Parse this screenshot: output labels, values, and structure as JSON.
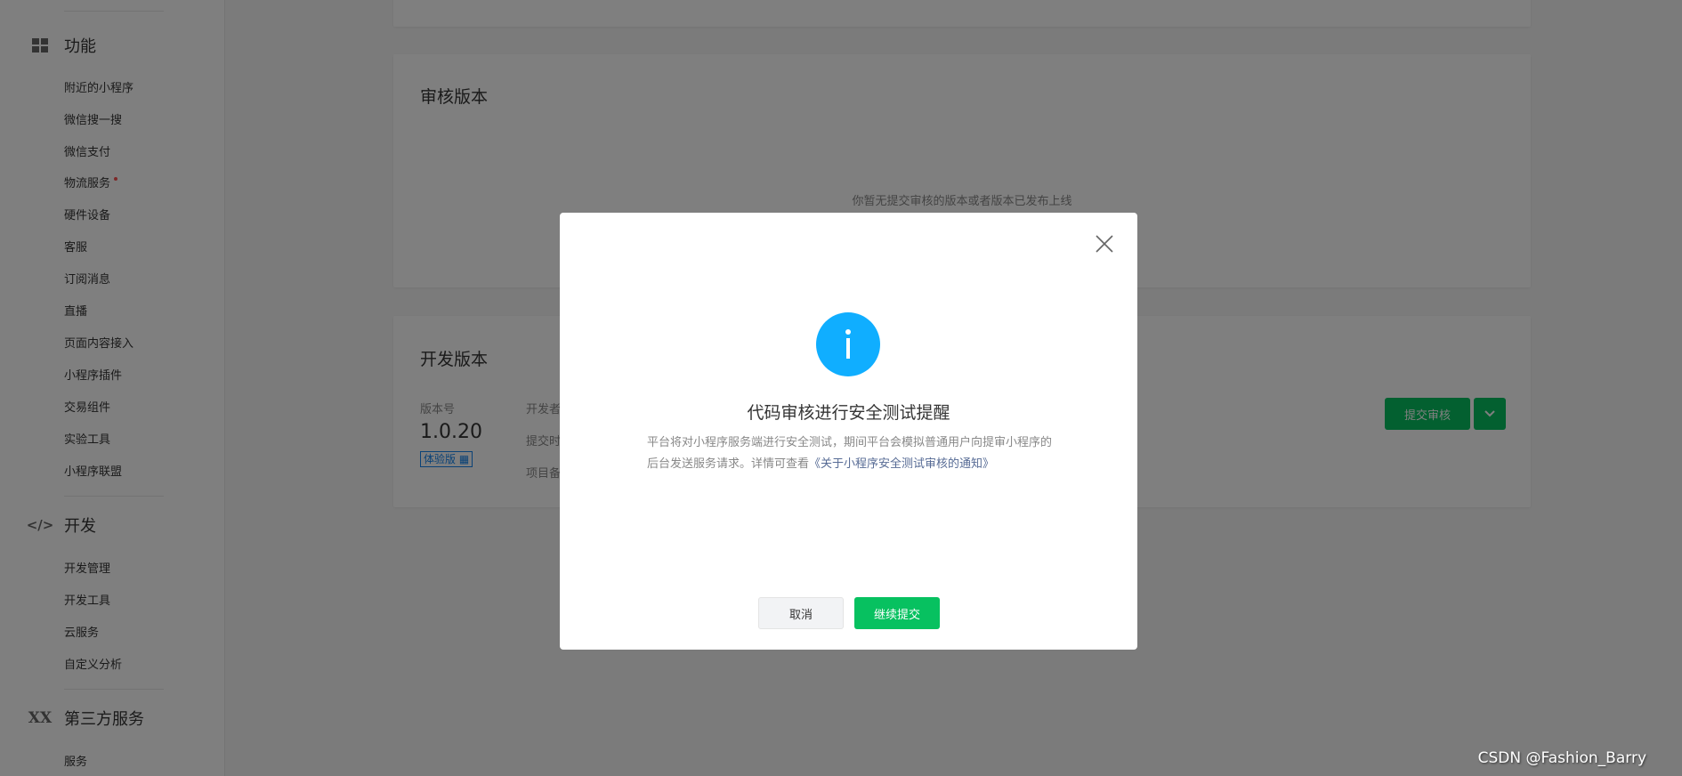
{
  "sidebar": {
    "sections": [
      {
        "title": "功能",
        "icon": "grid-icon",
        "items": [
          "附近的小程序",
          "微信搜一搜",
          "微信支付",
          "物流服务",
          "硬件设备",
          "客服",
          "订阅消息",
          "直播",
          "页面内容接入",
          "小程序插件",
          "交易组件",
          "实验工具",
          "小程序联盟"
        ]
      },
      {
        "title": "开发",
        "icon": "code-icon",
        "items": [
          "开发管理",
          "开发工具",
          "云服务",
          "自定义分析"
        ]
      },
      {
        "title": "第三方服务",
        "icon": "third-party-icon",
        "items": [
          "服务"
        ]
      }
    ]
  },
  "review": {
    "title": "审核版本",
    "empty": "你暂无提交审核的版本或者版本已发布上线"
  },
  "dev": {
    "title": "开发版本",
    "version_label": "版本号",
    "version": "1.0.20",
    "badge": "体验版",
    "developer_label": "开发者",
    "time_label": "提交时间",
    "note_label": "项目备注",
    "submit": "提交审核"
  },
  "modal": {
    "title": "代码审核进行安全测试提醒",
    "body": "平台将对小程序服务端进行安全测试，期间平台会模拟普通用户向提审小程序的后台发送服务请求。详情可查看",
    "link": "《关于小程序安全测试审核的通知》",
    "cancel": "取消",
    "confirm": "继续提交"
  },
  "watermark": "CSDN @Fashion_Barry",
  "colors": {
    "primary": "#07c160",
    "info": "#10aeff",
    "link": "#576b95"
  }
}
